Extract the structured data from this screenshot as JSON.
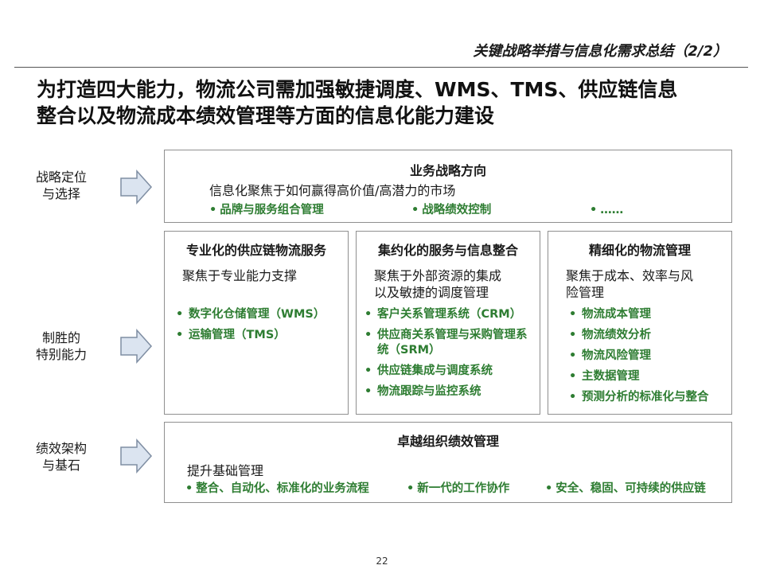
{
  "header": {
    "title": "关键战略举措与信息化需求总结（2/2）"
  },
  "headline": {
    "line1": "为打造四大能力，物流公司需加强敏捷调度、WMS、TMS、供应链信息",
    "line2": "整合以及物流成本绩效管理等方面的信息化能力建设"
  },
  "rows": {
    "strategy": {
      "line1": "战略定位",
      "line2": "与选择"
    },
    "capability": {
      "line1": "制胜的",
      "line2": "特别能力"
    },
    "performance": {
      "line1": "绩效架构",
      "line2": "与基石"
    }
  },
  "top_box": {
    "title": "业务战略方向",
    "desc": "信息化聚焦于如何赢得高价值/高潜力的市场",
    "bullets": [
      "品牌与服务组合管理",
      "战略绩效控制",
      "……"
    ]
  },
  "columns": [
    {
      "title": "专业化的供应链物流服务",
      "desc_lines": [
        "聚焦于专业能力支撑"
      ],
      "bullets": [
        "数字化仓储管理（WMS）",
        "运输管理（TMS）"
      ]
    },
    {
      "title": "集约化的服务与信息整合",
      "desc_lines": [
        "聚焦于外部资源的集成",
        "以及敏捷的调度管理"
      ],
      "bullets": [
        "客户关系管理系统（CRM）",
        "供应商关系管理与采购管理系统（SRM）",
        "供应链集成与调度系统",
        "物流跟踪与监控系统"
      ]
    },
    {
      "title": "精细化的物流管理",
      "desc_lines": [
        "聚焦于成本、效率与风",
        "险管理"
      ],
      "bullets": [
        "物流成本管理",
        "物流绩效分析",
        "物流风险管理",
        "主数据管理",
        "预测分析的标准化与整合"
      ]
    }
  ],
  "bottom_box": {
    "title": "卓越组织绩效管理",
    "desc": "提升基础管理",
    "bullets": [
      "整合、自动化、标准化的业务流程",
      "新一代的工作协作",
      "安全、稳固、可持续的供应链"
    ]
  },
  "bullet_symbol": "•",
  "page_number": "22",
  "colors": {
    "bullet_text": "#2e7d32",
    "border": "#8f8f8f",
    "arrow_fill": "#dbe4f0",
    "arrow_stroke": "#7f8ea3"
  }
}
